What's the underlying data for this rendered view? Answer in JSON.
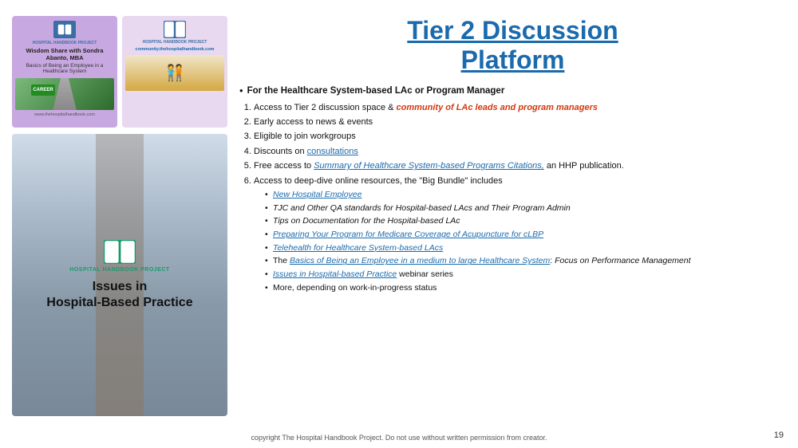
{
  "slide": {
    "title_line1": "Tier 2 Discussion",
    "title_line2": "Platform",
    "left": {
      "card_wisdom": {
        "label": "HOSPITAL HANDBOOK PROJECT",
        "title": "Wisdom Share with Sondra Abanto, MBA",
        "subtitle": "Basics of Being an Employee in a Healthcare System",
        "url": "www.thehospitalhandbook.com"
      },
      "card_community": {
        "label": "HOSPITAL HANDBOOK PROJECT",
        "url": "community.thehospitalhandbook.com"
      },
      "bottom_card": {
        "hhp_label": "HOSPITAL HANDBOOK PROJECT",
        "title_line1": "Issues in",
        "title_line2": "Hospital-Based Practice"
      }
    },
    "right": {
      "main_bullet_bold": "For the Healthcare System-based LAc or Program Manager",
      "items": [
        {
          "num": "1.",
          "text_plain": "Access to Tier 2 discussion space & ",
          "text_linked": "community of LAc leads and program managers"
        },
        {
          "num": "2.",
          "text": "Early access to news & events"
        },
        {
          "num": "3.",
          "text": "Eligible to join workgroups"
        },
        {
          "num": "4.",
          "text_plain": "Discounts on ",
          "text_linked": "consultations"
        },
        {
          "num": "5.",
          "text_plain": "Free access to ",
          "text_italic_link": "Summary of Healthcare System-based Programs Citations,",
          "text_suffix": " an HHP publication."
        },
        {
          "num": "6.",
          "text": "Access to deep-dive online resources, the “Big Bundle” includes",
          "subitems": [
            {
              "text": "New Hospital Employee",
              "is_link": true
            },
            {
              "text": "TJC and Other QA standards for Hospital-based LAcs and Their Program Admin",
              "is_link": false
            },
            {
              "text": "Tips on Documentation for the Hospital-based LAc",
              "is_link": false
            },
            {
              "text": "Preparing Your Program for Medicare Coverage of Acupuncture for cLBP",
              "is_link": true
            },
            {
              "text": "Telehealth for Healthcare System-based LAcs",
              "is_link": true
            },
            {
              "text_plain": "The ",
              "text_link": "Basics of Being an Employee in a medium to large Healthcare System",
              "text_suffix": ": Focus on Performance Management",
              "is_mixed": true
            },
            {
              "text_link": "Issues in Hospital-based Practice",
              "text_suffix": " webinar series",
              "is_mixed_simple": true
            },
            {
              "text": "More, depending on work-in-progress status",
              "is_link": false
            }
          ]
        }
      ]
    },
    "footer": {
      "text": "copyright The Hospital Handbook Project. Do not use without written permission from creator.",
      "page_number": "19"
    }
  }
}
